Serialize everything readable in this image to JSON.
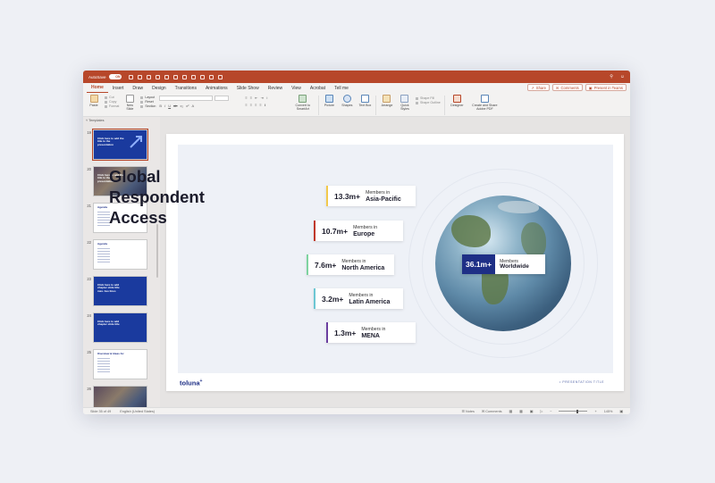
{
  "titlebar": {
    "autosave_label": "AutoSave",
    "autosave_state": "ON"
  },
  "tabs": [
    "Home",
    "Insert",
    "Draw",
    "Design",
    "Transitions",
    "Animations",
    "Slide Show",
    "Review",
    "View",
    "Acrobat",
    "Tell me"
  ],
  "ribbon_actions": {
    "share": "Share",
    "comments": "Comments",
    "present": "Present in Teams"
  },
  "toolbar": {
    "paste": "Paste",
    "cut": "Cut",
    "copy": "Copy",
    "format": "Format",
    "new_slide": "New Slide",
    "layout": "Layout",
    "reset": "Reset",
    "section": "Section",
    "convert": "Convert to SmartArt",
    "picture": "Picture",
    "shapes": "Shapes",
    "textbox": "Text Box",
    "arrange": "Arrange",
    "quick_styles": "Quick Styles",
    "shape_fill": "Shape Fill",
    "shape_outline": "Shape Outline",
    "designer": "Designer",
    "adobe": "Create and Share Adobe PDF"
  },
  "panel": {
    "header": "Templates",
    "thumbs": [
      {
        "num": "19",
        "style": "blue",
        "text": "Click here to add the title to the presentation"
      },
      {
        "num": "20",
        "style": "photo",
        "text": "Click here to add the title to the presentation"
      },
      {
        "num": "21",
        "style": "white",
        "text": "Agenda"
      },
      {
        "num": "22",
        "style": "white",
        "text": "Agenda"
      },
      {
        "num": "23",
        "style": "blue",
        "text": "Click here to add chapter slide title max. two lines"
      },
      {
        "num": "24",
        "style": "blue",
        "text": "Click here to add chapter slide title"
      },
      {
        "num": "25",
        "style": "white",
        "text": "Overview & Ideas for"
      },
      {
        "num": "26",
        "style": "photo",
        "text": ""
      }
    ]
  },
  "slide": {
    "title_lines": [
      "Global",
      "Respondent",
      "Access"
    ],
    "regions": [
      {
        "value": "13.3m+",
        "prefix": "Members in",
        "region": "Asia-Pacific",
        "color": "#f2c94c"
      },
      {
        "value": "10.7m+",
        "prefix": "Members in",
        "region": "Europe",
        "color": "#c0392b"
      },
      {
        "value": "7.6m+",
        "prefix": "Members in",
        "region": "North America",
        "color": "#7ed3a0"
      },
      {
        "value": "3.2m+",
        "prefix": "Members in",
        "region": "Latin America",
        "color": "#6cc7d4"
      },
      {
        "value": "1.3m+",
        "prefix": "Members in",
        "region": "MENA",
        "color": "#6b3fa0"
      }
    ],
    "worldwide": {
      "value": "36.1m+",
      "prefix": "Members",
      "region": "Worldwide"
    },
    "logo": "toluna",
    "footer": "PRESENTATION TITLE"
  },
  "status": {
    "slide_info": "Slide 35 of 49",
    "language": "English (United States)",
    "notes": "Notes",
    "comments": "Comments",
    "zoom": "145%"
  }
}
